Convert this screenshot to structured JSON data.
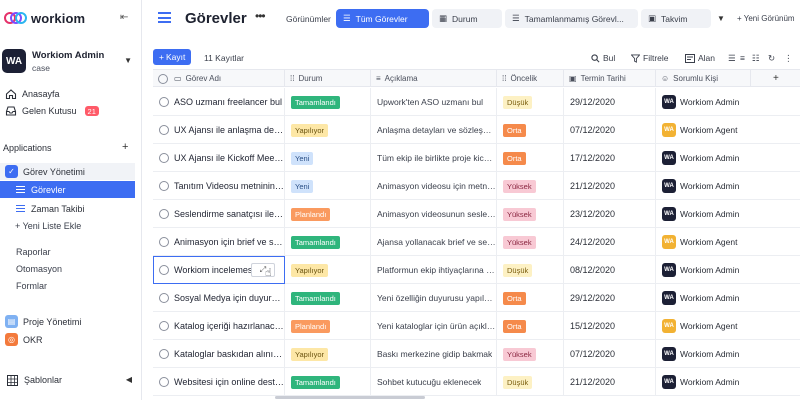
{
  "app": {
    "brand": "workiom",
    "account_name": "Workiom Admin",
    "account_sub": "case",
    "account_initials": "WA"
  },
  "nav": {
    "home": "Anasayfa",
    "inbox": "Gelen Kutusu",
    "inbox_count": "21"
  },
  "applications": {
    "title": "Applications",
    "task_app": "Görev Yönetimi",
    "lists": [
      "Görevler",
      "Zaman Takibi"
    ],
    "new_list": "+ Yeni Liste Ekle",
    "links": [
      "Raporlar",
      "Otomasyon",
      "Formlar"
    ],
    "other_apps": [
      "Proje Yönetimi",
      "OKR"
    ],
    "templates": "Şablonlar"
  },
  "header": {
    "title": "Görevler",
    "views_label": "Görünümler",
    "views": [
      "Tüm Görevler",
      "Durum",
      "Tamamlanmamış Görevl...",
      "Takvim"
    ],
    "new_view": "+ Yeni Görünüm"
  },
  "toolbar": {
    "add_label": "Kayıt",
    "record_count": "11 Kayıtlar",
    "search": "Bul",
    "filter": "Filtrele",
    "fields": "Alan"
  },
  "columns": [
    "Görev Adı",
    "Durum",
    "Açıklama",
    "Öncelik",
    "Termin Tarihi",
    "Sorumlu Kişi"
  ],
  "rows": [
    {
      "name": "ASO uzmanı freelancer bul",
      "status": "Tamamlandı",
      "desc": "Upwork'ten ASO uzmanı bul",
      "priority": "Düşük",
      "date": "29/12/2020",
      "assignee": "Workiom Admin",
      "avatar": "WA"
    },
    {
      "name": "UX Ajansı ile anlaşma detaylarını belirle",
      "status": "Yapılıyor",
      "desc": "Anlaşma detayları ve sözleşme taslağı",
      "priority": "Orta",
      "date": "07/12/2020",
      "assignee": "Workiom Agent",
      "avatar": "WA"
    },
    {
      "name": "UX Ajansı ile Kickoff Meeting",
      "status": "Yeni",
      "desc": "Tüm ekip ile birlikte proje kickoff",
      "priority": "Orta",
      "date": "17/12/2020",
      "assignee": "Workiom Admin",
      "avatar": "WA"
    },
    {
      "name": "Tanıtım Videosu metninin yazılması",
      "status": "Yeni",
      "desc": "Animasyon videosu için metnin yazılması",
      "priority": "Yüksek",
      "date": "21/12/2020",
      "assignee": "Workiom Admin",
      "avatar": "WA"
    },
    {
      "name": "Seslendirme sanatçısı ile anlaş",
      "status": "Planlandı",
      "desc": "Animasyon videosunun seslendirmesi",
      "priority": "Yüksek",
      "date": "23/12/2020",
      "assignee": "Workiom Admin",
      "avatar": "WA"
    },
    {
      "name": "Animasyon için brief ve senaryo",
      "status": "Tamamlandı",
      "desc": "Ajansa yollanacak brief ve senaryo",
      "priority": "Yüksek",
      "date": "24/12/2020",
      "assignee": "Workiom Agent",
      "avatar": "WA"
    },
    {
      "name": "Workiom incelemesi",
      "status": "Yapılıyor",
      "desc": "Platformun ekip ihtiyaçlarına uygunluğu",
      "priority": "Düşük",
      "date": "08/12/2020",
      "assignee": "Workiom Admin",
      "avatar": "WA"
    },
    {
      "name": "Sosyal Medya için duyuru postu",
      "status": "Tamamlandı",
      "desc": "Yeni özelliğin duyurusu yapılacak",
      "priority": "Orta",
      "date": "29/12/2020",
      "assignee": "Workiom Admin",
      "avatar": "WA"
    },
    {
      "name": "Katalog içeriği hazırlanacak",
      "status": "Planlandı",
      "desc": "Yeni kataloglar için ürün açıklamaları",
      "priority": "Orta",
      "date": "15/12/2020",
      "assignee": "Workiom Agent",
      "avatar": "WA"
    },
    {
      "name": "Kataloglar baskıdan alınıp dağıtılacak",
      "status": "Yapılıyor",
      "desc": "Baskı merkezine gidip bakmak",
      "priority": "Yüksek",
      "date": "07/12/2020",
      "assignee": "Workiom Admin",
      "avatar": "WA"
    },
    {
      "name": "Websitesi için online destek",
      "status": "Tamamlandı",
      "desc": "Sohbet kutucuğu eklenecek",
      "priority": "Düşük",
      "date": "21/12/2020",
      "assignee": "Workiom Admin",
      "avatar": "WA"
    }
  ],
  "colors": {
    "accent": "#3d6df2",
    "status": {
      "Tamamlandı": {
        "bg": "#2fb57c",
        "fg": "#ffffff"
      },
      "Yapılıyor": {
        "bg": "#fde7a6",
        "fg": "#6b5410"
      },
      "Yeni": {
        "bg": "#cfe2fb",
        "fg": "#2a4f86"
      },
      "Planlandı": {
        "bg": "#fa9a5f",
        "fg": "#ffffff"
      }
    },
    "priority": {
      "Düşük": {
        "bg": "#fdf1c4",
        "fg": "#7a5d0e"
      },
      "Orta": {
        "bg": "#f58a4b",
        "fg": "#ffffff"
      },
      "Yüksek": {
        "bg": "#f8c9d4",
        "fg": "#8a2640"
      }
    },
    "avatar": {
      "Workiom Admin": "#1c2035",
      "Workiom Agent": "#f2b233"
    }
  }
}
